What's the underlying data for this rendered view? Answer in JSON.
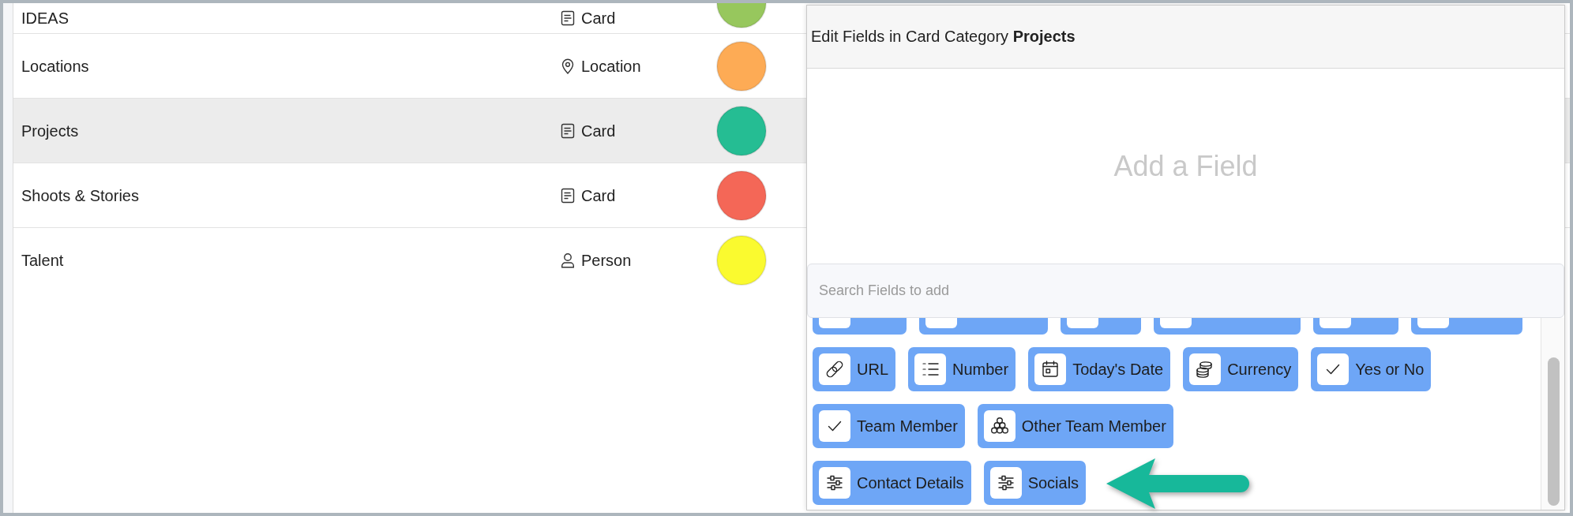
{
  "categories": [
    {
      "name": "IDEAS",
      "kind": "card",
      "type": "Card",
      "color": "#97c75d",
      "selected": false
    },
    {
      "name": "Locations",
      "kind": "location",
      "type": "Location",
      "color": "#fdab55",
      "selected": false
    },
    {
      "name": "Projects",
      "kind": "card",
      "type": "Card",
      "color": "#25bd93",
      "selected": true
    },
    {
      "name": "Shoots & Stories",
      "kind": "card",
      "type": "Card",
      "color": "#f46757",
      "selected": false
    },
    {
      "name": "Talent",
      "kind": "person",
      "type": "Person",
      "color": "#fafa2f",
      "selected": false
    }
  ],
  "dialog": {
    "title": "Edit Fields in Card Category **Projects**",
    "empty_text": "Add a Field",
    "search": {
      "placeholder": "Search Fields to add"
    },
    "field_groups": [
      {
        "chips": [
          {
            "kind": "cut"
          },
          {
            "kind": "cut"
          },
          {
            "kind": "cut"
          },
          {
            "kind": "cut"
          },
          {
            "kind": "cut"
          },
          {
            "kind": "cut"
          }
        ]
      },
      {
        "chips": [
          {
            "label": "URL",
            "kind": "link"
          },
          {
            "label": "Number",
            "kind": "list"
          },
          {
            "label": "Today's Date",
            "kind": "calendar"
          },
          {
            "label": "Currency",
            "kind": "coins"
          },
          {
            "label": "Yes or No",
            "kind": "check"
          }
        ]
      },
      {
        "chips": [
          {
            "label": "Team Member",
            "kind": "check"
          },
          {
            "label": "Other Team Member",
            "kind": "circles"
          }
        ]
      },
      {
        "chips": [
          {
            "label": "Contact Details",
            "kind": "sliders"
          },
          {
            "label": "Socials",
            "kind": "sliders"
          }
        ]
      }
    ]
  }
}
